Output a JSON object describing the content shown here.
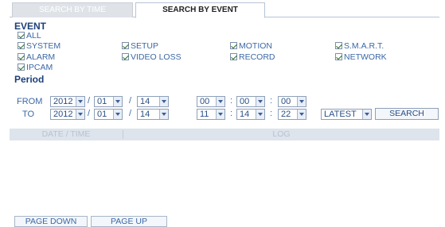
{
  "tabs": [
    "SEARCH BY TIME",
    "SEARCH BY EVENT"
  ],
  "event_section": {
    "title": "EVENT",
    "events": [
      {
        "label": "ALL",
        "checked": true
      },
      {
        "label": "SYSTEM",
        "checked": true
      },
      {
        "label": "SETUP",
        "checked": true
      },
      {
        "label": "MOTION",
        "checked": true
      },
      {
        "label": "S.M.A.R.T.",
        "checked": true
      },
      {
        "label": "ALARM",
        "checked": true
      },
      {
        "label": "VIDEO LOSS",
        "checked": true
      },
      {
        "label": "RECORD",
        "checked": true
      },
      {
        "label": "NETWORK",
        "checked": true
      },
      {
        "label": "IPCAM",
        "checked": true
      }
    ]
  },
  "period": {
    "title": "Period",
    "from": {
      "label": "FROM",
      "year": "2012",
      "month": "01",
      "day": "14",
      "hour": "00",
      "minute": "00",
      "second": "00"
    },
    "to": {
      "label": "TO",
      "year": "2012",
      "month": "01",
      "day": "14",
      "hour": "11",
      "minute": "14",
      "second": "22"
    },
    "date_sep": "/",
    "time_sep": ":",
    "order": "LATEST",
    "search_label": "SEARCH"
  },
  "log": {
    "col_date": "DATE / TIME",
    "col_log": "LOG",
    "rows": []
  },
  "pager": {
    "down": "PAGE DOWN",
    "up": "PAGE UP"
  },
  "colors": {
    "accent": "#2a4f86",
    "header_bg": "#dde4ec",
    "check": "#2b6e2b"
  },
  "icons": {
    "checkbox": "check-icon",
    "dropdown": "chevron-down-icon"
  }
}
